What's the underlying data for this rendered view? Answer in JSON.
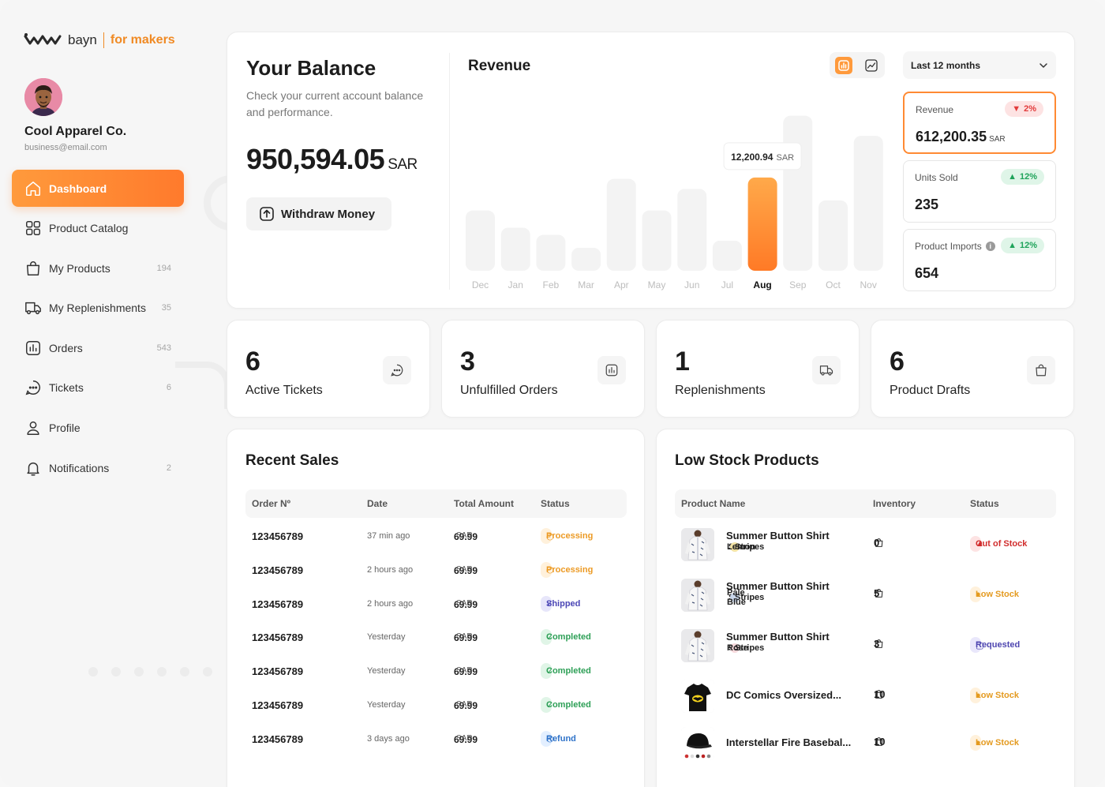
{
  "brand": {
    "name": "bayn",
    "tagline": "for makers"
  },
  "user": {
    "company": "Cool Apparel Co.",
    "email": "business@email.com"
  },
  "nav": [
    {
      "label": "Dashboard",
      "count": "",
      "icon": "home-icon",
      "active": true
    },
    {
      "label": "Product Catalog",
      "count": "",
      "icon": "grid-icon"
    },
    {
      "label": "My Products",
      "count": "194",
      "icon": "bag-icon"
    },
    {
      "label": "My Replenishments",
      "count": "35",
      "icon": "truck-icon"
    },
    {
      "label": "Orders",
      "count": "543",
      "icon": "chart-box-icon"
    },
    {
      "label": "Tickets",
      "count": "6",
      "icon": "chat-icon"
    },
    {
      "label": "Profile",
      "count": "",
      "icon": "user-icon"
    },
    {
      "label": "Notifications",
      "count": "2",
      "icon": "bell-icon"
    }
  ],
  "balance": {
    "title": "Your Balance",
    "subtitle": "Check your current account balance and performance.",
    "amount": "950,594.05",
    "currency": "SAR",
    "withdraw_label": "Withdraw Money"
  },
  "revenue": {
    "title": "Revenue",
    "period": "Last 12 months",
    "tooltip_value": "12,200.94",
    "tooltip_currency": "SAR"
  },
  "chart_data": {
    "type": "bar",
    "categories": [
      "Dec",
      "Jan",
      "Feb",
      "Mar",
      "Apr",
      "May",
      "Jun",
      "Jul",
      "Aug",
      "Sep",
      "Oct",
      "Nov"
    ],
    "values": [
      4.2,
      3.0,
      2.5,
      1.6,
      6.4,
      4.2,
      5.7,
      2.1,
      6.5,
      10.8,
      4.9,
      9.4
    ],
    "highlighted": "Aug",
    "highlight_color": "#ff8a33",
    "bar_color": "#f3f3f3",
    "ylim": [
      0,
      11
    ],
    "grid": false
  },
  "stats": [
    {
      "label": "Revenue",
      "value": "612,200.35",
      "currency": "SAR",
      "change": "2%",
      "direction": "down",
      "info": ""
    },
    {
      "label": "Units Sold",
      "value": "235",
      "currency": "",
      "change": "12%",
      "direction": "up",
      "info": ""
    },
    {
      "label": "Product Imports",
      "value": "654",
      "currency": "",
      "change": "12%",
      "direction": "up",
      "info": "i"
    }
  ],
  "kpis": [
    {
      "value": "6",
      "label": "Active Tickets",
      "icon": "chat-icon"
    },
    {
      "value": "3",
      "label": "Unfulfilled Orders",
      "icon": "chart-box-icon"
    },
    {
      "value": "1",
      "label": "Replenishments",
      "icon": "truck-icon"
    },
    {
      "value": "6",
      "label": "Product Drafts",
      "icon": "bag-icon"
    }
  ],
  "recent_sales": {
    "title": "Recent Sales",
    "columns": [
      "Order Nº",
      "Date",
      "Total Amount",
      "Status"
    ],
    "rows": [
      {
        "order": "123456789",
        "date": "37 min ago",
        "amount": "69.99",
        "currency": "SAR",
        "status": "Processing",
        "kind": "processing"
      },
      {
        "order": "123456789",
        "date": "2 hours ago",
        "amount": "69.99",
        "currency": "SAR",
        "status": "Processing",
        "kind": "processing"
      },
      {
        "order": "123456789",
        "date": "2 hours ago",
        "amount": "69.99",
        "currency": "SAR",
        "status": "Shipped",
        "kind": "shipped"
      },
      {
        "order": "123456789",
        "date": "Yesterday",
        "amount": "69.99",
        "currency": "SAR",
        "status": "Completed",
        "kind": "completed"
      },
      {
        "order": "123456789",
        "date": "Yesterday",
        "amount": "69.99",
        "currency": "SAR",
        "status": "Completed",
        "kind": "completed"
      },
      {
        "order": "123456789",
        "date": "Yesterday",
        "amount": "69.99",
        "currency": "SAR",
        "status": "Completed",
        "kind": "completed"
      },
      {
        "order": "123456789",
        "date": "3 days ago",
        "amount": "69.99",
        "currency": "SAR",
        "status": "Refund",
        "kind": "refund"
      }
    ]
  },
  "low_stock": {
    "title": "Low Stock Products",
    "columns": [
      "Product Name",
      "Inventory",
      "Status"
    ],
    "rows": [
      {
        "name": "Summer Button Shirt",
        "size": "S",
        "color": "Lemon",
        "swatch": "#f3e3a4",
        "pattern": "Stripes",
        "inventory": "0",
        "status": "Out of Stock",
        "kind": "out",
        "img": "shirt"
      },
      {
        "name": "Summer Button Shirt",
        "size": "S",
        "color": "Pale Blue",
        "swatch": "#c9d6ea",
        "pattern": "Stripes",
        "inventory": "5",
        "status": "Low Stock",
        "kind": "low",
        "img": "shirt"
      },
      {
        "name": "Summer Button Shirt",
        "size": "S",
        "color": "Rose",
        "swatch": "#f6d9dc",
        "pattern": "Stripes",
        "inventory": "3",
        "status": "Requested",
        "kind": "requested",
        "img": "shirt"
      },
      {
        "name": "DC Comics Oversized...",
        "size": "",
        "color": "",
        "swatch": "",
        "pattern": "",
        "inventory": "10",
        "status": "Low Stock",
        "kind": "low",
        "img": "tshirt"
      },
      {
        "name": "Interstellar Fire Basebal...",
        "size": "",
        "color": "",
        "swatch": "",
        "pattern": "",
        "inventory": "10",
        "status": "Low Stock",
        "kind": "low",
        "img": "cap"
      }
    ]
  }
}
